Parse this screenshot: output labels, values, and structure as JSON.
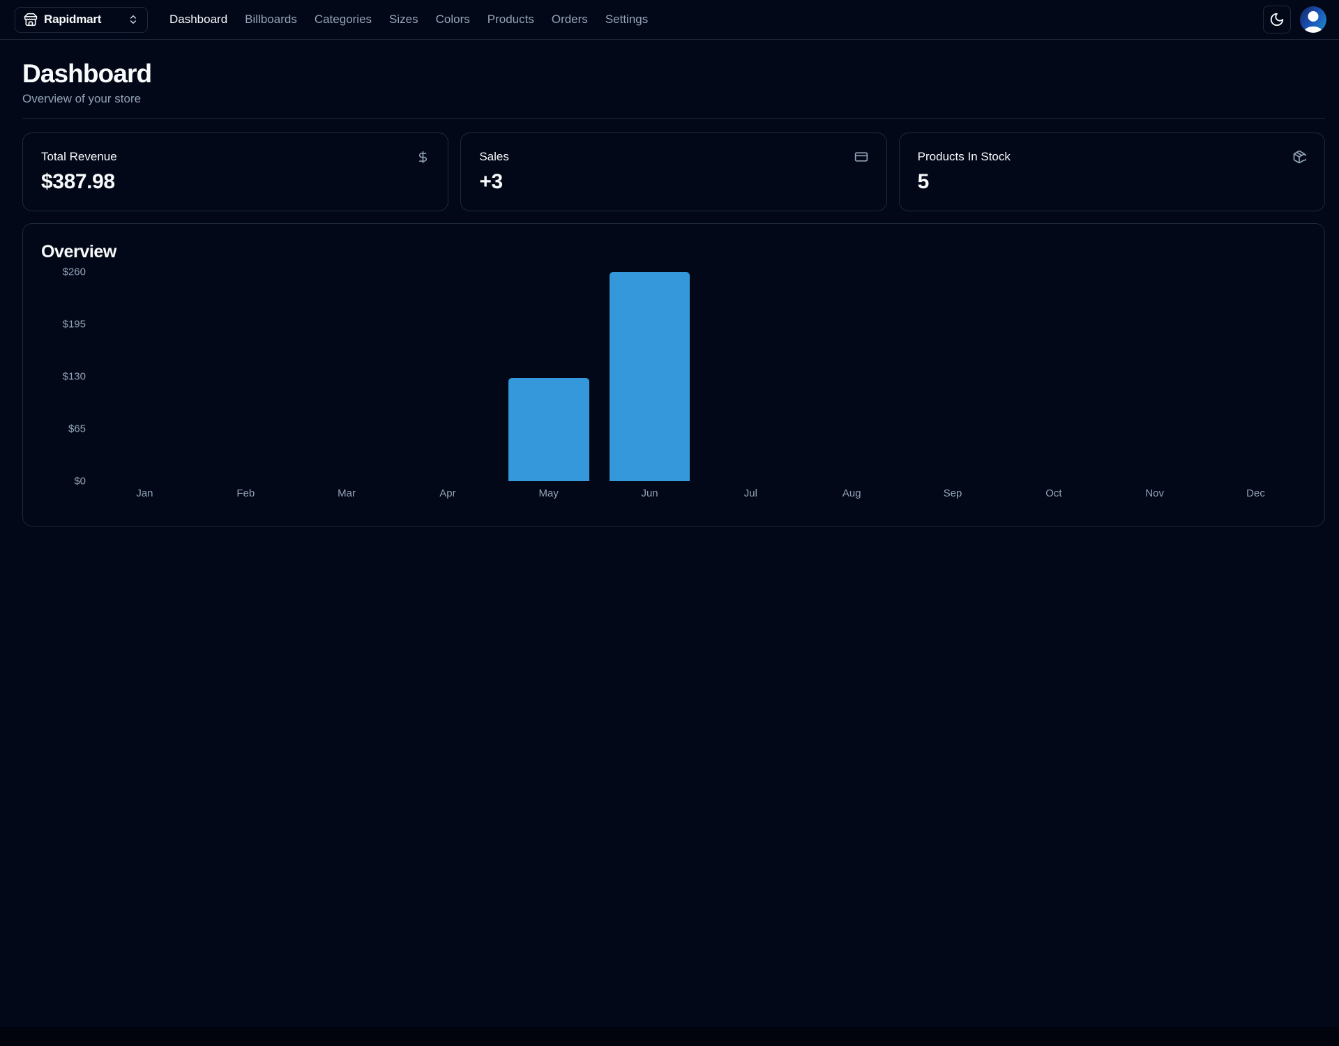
{
  "store_switcher": {
    "name": "Rapidmart",
    "icon": "store-icon",
    "caret_icon": "chevrons-up-down-icon"
  },
  "nav": {
    "items": [
      {
        "label": "Dashboard",
        "active": true
      },
      {
        "label": "Billboards",
        "active": false
      },
      {
        "label": "Categories",
        "active": false
      },
      {
        "label": "Sizes",
        "active": false
      },
      {
        "label": "Colors",
        "active": false
      },
      {
        "label": "Products",
        "active": false
      },
      {
        "label": "Orders",
        "active": false
      },
      {
        "label": "Settings",
        "active": false
      }
    ]
  },
  "topbar_right": {
    "theme_toggle_icon": "moon-icon",
    "avatar": "user-avatar"
  },
  "header": {
    "title": "Dashboard",
    "subtitle": "Overview of your store"
  },
  "stats": [
    {
      "label": "Total Revenue",
      "value": "$387.98",
      "icon": "dollar-sign-icon"
    },
    {
      "label": "Sales",
      "value": "+3",
      "icon": "credit-card-icon"
    },
    {
      "label": "Products In Stock",
      "value": "5",
      "icon": "package-icon"
    }
  ],
  "chart_card": {
    "title": "Overview"
  },
  "chart_data": {
    "type": "bar",
    "title": "Overview",
    "categories": [
      "Jan",
      "Feb",
      "Mar",
      "Apr",
      "May",
      "Jun",
      "Jul",
      "Aug",
      "Sep",
      "Oct",
      "Nov",
      "Dec"
    ],
    "values": [
      0,
      0,
      0,
      0,
      128,
      260,
      0,
      0,
      0,
      0,
      0,
      0
    ],
    "xlabel": "",
    "ylabel": "",
    "ylim": [
      0,
      260
    ],
    "yticks": [
      0,
      65,
      130,
      195,
      260
    ],
    "ytick_labels": [
      "$0",
      "$65",
      "$130",
      "$195",
      "$260"
    ],
    "bar_color": "#3498db",
    "grid": false,
    "legend": false
  },
  "colors": {
    "background": "#020817",
    "border": "#1e293b",
    "foreground": "#f8fafc",
    "muted": "#94a3b8",
    "bar": "#3498db"
  }
}
